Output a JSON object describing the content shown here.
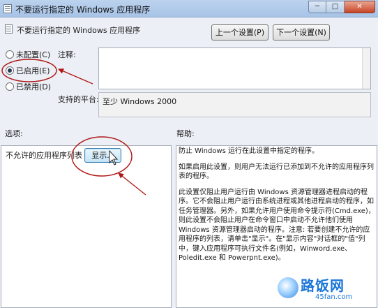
{
  "window": {
    "title": "不要运行指定的 Windows 应用程序",
    "controls": {
      "minimize": "─",
      "maximize": "□",
      "close": "✕"
    }
  },
  "policy": {
    "title": "不要运行指定的 Windows 应用程序"
  },
  "nav": {
    "prev_label": "上一个设置(P)",
    "next_label": "下一个设置(N)"
  },
  "state": {
    "options": [
      {
        "label": "未配置(C)",
        "selected": false
      },
      {
        "label": "已启用(E)",
        "selected": true
      },
      {
        "label": "已禁用(D)",
        "selected": false
      }
    ]
  },
  "comment": {
    "label": "注释:",
    "value": ""
  },
  "platform": {
    "label": "支持的平台:",
    "value": "至少 Windows 2000"
  },
  "options_pane": {
    "label": "选项:",
    "setting_label": "不允许的应用程序列表",
    "show_button": "显示..."
  },
  "help_pane": {
    "label": "帮助:",
    "paragraphs": [
      "防止 Windows 运行在此设置中指定的程序。",
      "如果启用此设置，则用户无法运行已添加到不允许的应用程序列表的程序。",
      "此设置仅阻止用户运行由 Windows 资源管理器进程启动的程序。它不会阻止用户运行由系统进程或其他进程启动的程序，如任务管理器。另外，如果允许用户使用命令提示符(Cmd.exe)，则此设置不会阻止用户在命令窗口中启动不允许他们使用 Windows 资源管理器启动的程序。注意: 若要创建不允许的应用程序的列表，请单击\"显示\"。在\"显示内容\"对话框的\"值\"列中，键入应用程序可执行文件名(例如，Winword.exe、Poledit.exe 和 Powerpnt.exe)。"
    ]
  },
  "watermark": {
    "name": "路饭网",
    "url": "45fan.com"
  },
  "colors": {
    "annotation": "#b01818",
    "watermark": "#1875d8",
    "titlebar": "#b2cbea"
  }
}
